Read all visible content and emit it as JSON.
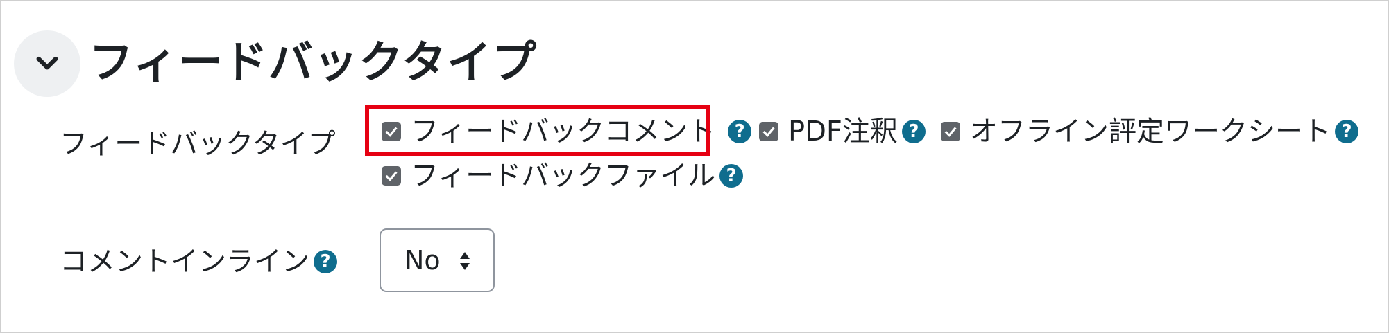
{
  "section": {
    "title": "フィードバックタイプ",
    "collapse_icon": "chevron-down-icon"
  },
  "feedback_types": {
    "label": "フィードバックタイプ",
    "options": [
      {
        "label": "フィードバックコメント",
        "checked": true,
        "highlighted": true
      },
      {
        "label": "PDF注釈",
        "checked": true
      },
      {
        "label": "オフライン評定ワークシート",
        "checked": true
      },
      {
        "label": "フィードバックファイル",
        "checked": true
      }
    ]
  },
  "comment_inline": {
    "label": "コメントインライン",
    "value": "No"
  },
  "help_glyph": "?",
  "colors": {
    "highlight": "#e60012",
    "help_icon": "#0f6d8e",
    "checkbox": "#5f6368"
  }
}
